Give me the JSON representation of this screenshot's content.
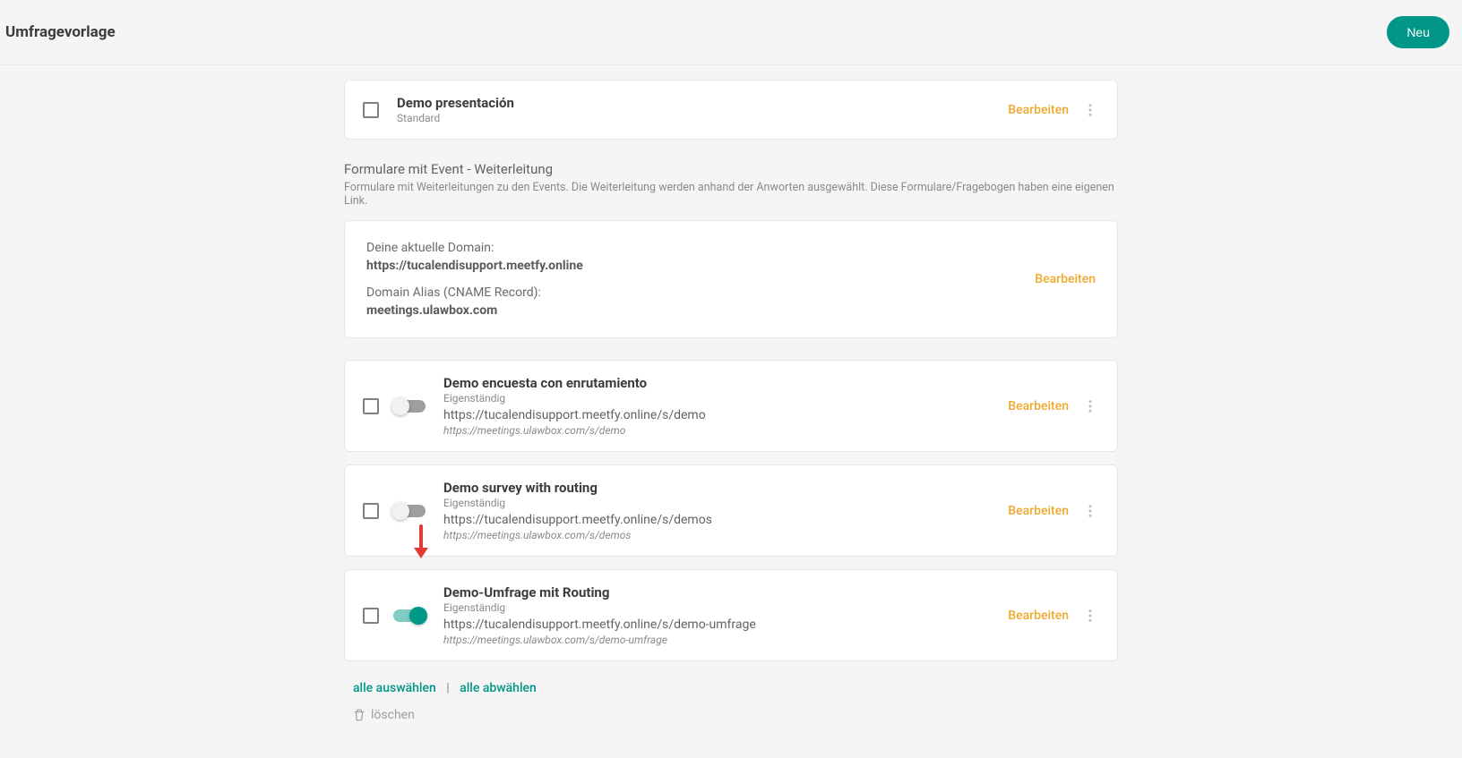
{
  "header": {
    "title": "Umfragevorlage",
    "new_button": "Neu"
  },
  "template_card": {
    "title": "Demo presentación",
    "subtitle": "Standard",
    "edit": "Bearbeiten"
  },
  "section": {
    "title": "Formulare mit Event - Weiterleitung",
    "description": "Formulare mit Weiterleitungen zu den Events. Die Weiterleitung werden anhand der Anworten ausgewählt. Diese Formulare/Fragebogen haben eine eigenen Link."
  },
  "domain_card": {
    "current_label": "Deine aktuelle Domain:",
    "current_value": "https://tucalendisupport.meetfy.online",
    "alias_label": "Domain Alias (CNAME Record):",
    "alias_value": "meetings.ulawbox.com",
    "edit": "Bearbeiten"
  },
  "surveys": [
    {
      "title": "Demo encuesta con enrutamiento",
      "type": "Eigenständig",
      "url": "https://tucalendisupport.meetfy.online/s/demo",
      "alias_url": "https://meetings.ulawbox.com/s/demo",
      "active": false,
      "edit": "Bearbeiten"
    },
    {
      "title": "Demo survey with routing",
      "type": "Eigenständig",
      "url": "https://tucalendisupport.meetfy.online/s/demos",
      "alias_url": "https://meetings.ulawbox.com/s/demos",
      "active": false,
      "edit": "Bearbeiten"
    },
    {
      "title": "Demo-Umfrage mit Routing",
      "type": "Eigenständig",
      "url": "https://tucalendisupport.meetfy.online/s/demo-umfrage",
      "alias_url": "https://meetings.ulawbox.com/s/demo-umfrage",
      "active": true,
      "edit": "Bearbeiten"
    }
  ],
  "footer": {
    "select_all": "alle auswählen",
    "deselect_all": "alle abwählen",
    "delete": "löschen"
  }
}
